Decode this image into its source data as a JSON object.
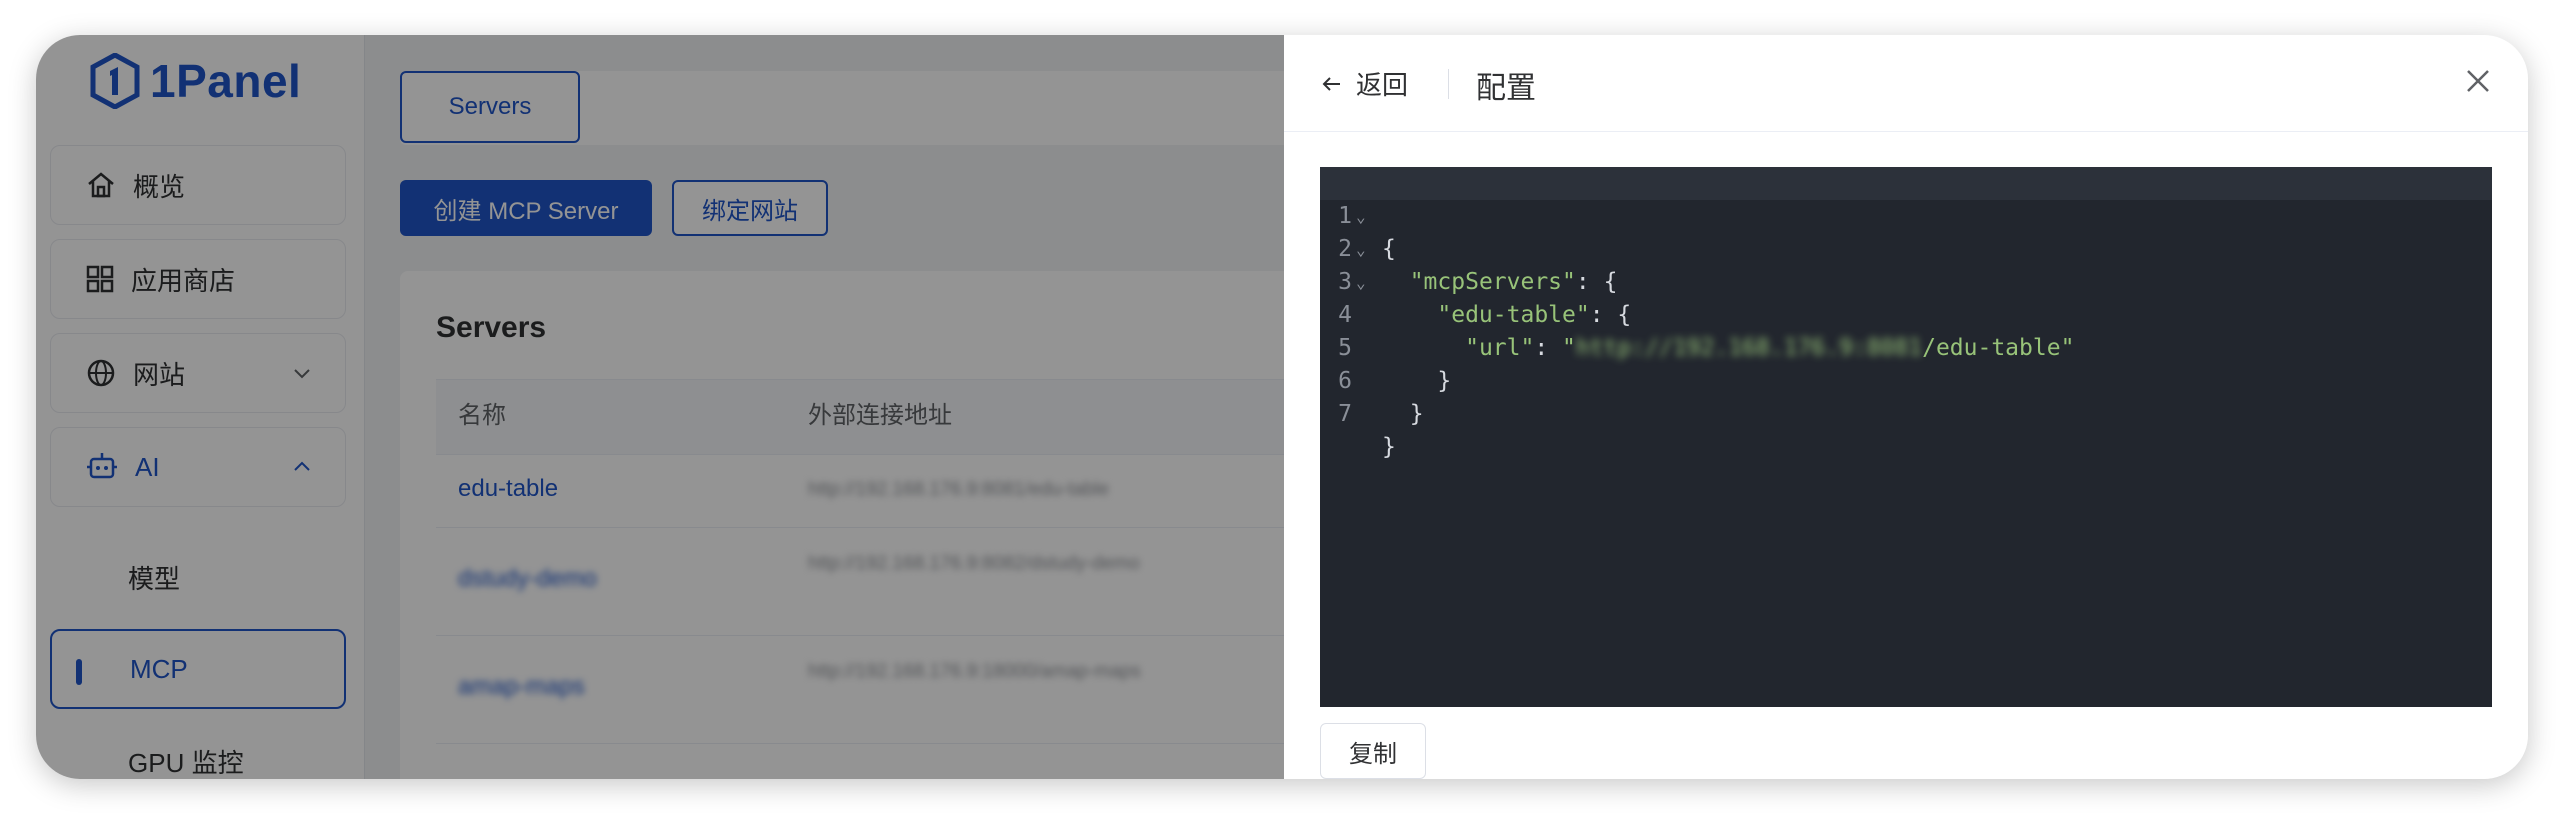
{
  "app": {
    "brand": "1Panel"
  },
  "sidebar": {
    "items": [
      {
        "label": "概览",
        "icon": "home-icon"
      },
      {
        "label": "应用商店",
        "icon": "grid-icon"
      },
      {
        "label": "网站",
        "icon": "globe-icon"
      },
      {
        "label": "AI",
        "icon": "robot-icon"
      }
    ],
    "ai_children": [
      {
        "label": "模型"
      },
      {
        "label": "MCP"
      },
      {
        "label": "GPU 监控"
      }
    ]
  },
  "main": {
    "tab_label": "Servers",
    "create_button": "创建 MCP Server",
    "bind_button": "绑定网站",
    "card_title": "Servers",
    "columns": [
      "名称",
      "外部连接地址"
    ],
    "rows": [
      {
        "name": "edu-table",
        "url": "http://192.168.176.9:8081/edu-table"
      },
      {
        "name": "dstudy-demo",
        "url": "http://192.168.176.9:8082/dstudy-demo"
      },
      {
        "name": "amap-maps",
        "url": "http://192.168.176.9:18000/amap-maps"
      }
    ]
  },
  "drawer": {
    "back_label": "返回",
    "title": "配置",
    "copy_button": "复制",
    "code_lines": [
      "{",
      "  \"mcpServers\": {",
      "    \"edu-table\": {",
      "      \"url\": \"http://192.168.176.9:8081/edu-table\"",
      "    }",
      "  }",
      "}"
    ],
    "code": {
      "key_mcp": "\"mcpServers\"",
      "key_edu": "\"edu-table\"",
      "key_url": "\"url\"",
      "url_hidden": "http://192.168.176.9:8081",
      "url_suffix": "/edu-table\""
    }
  },
  "colors": {
    "accent": "#1f55c8",
    "editor_bg": "#22262e",
    "string": "#98c379"
  }
}
